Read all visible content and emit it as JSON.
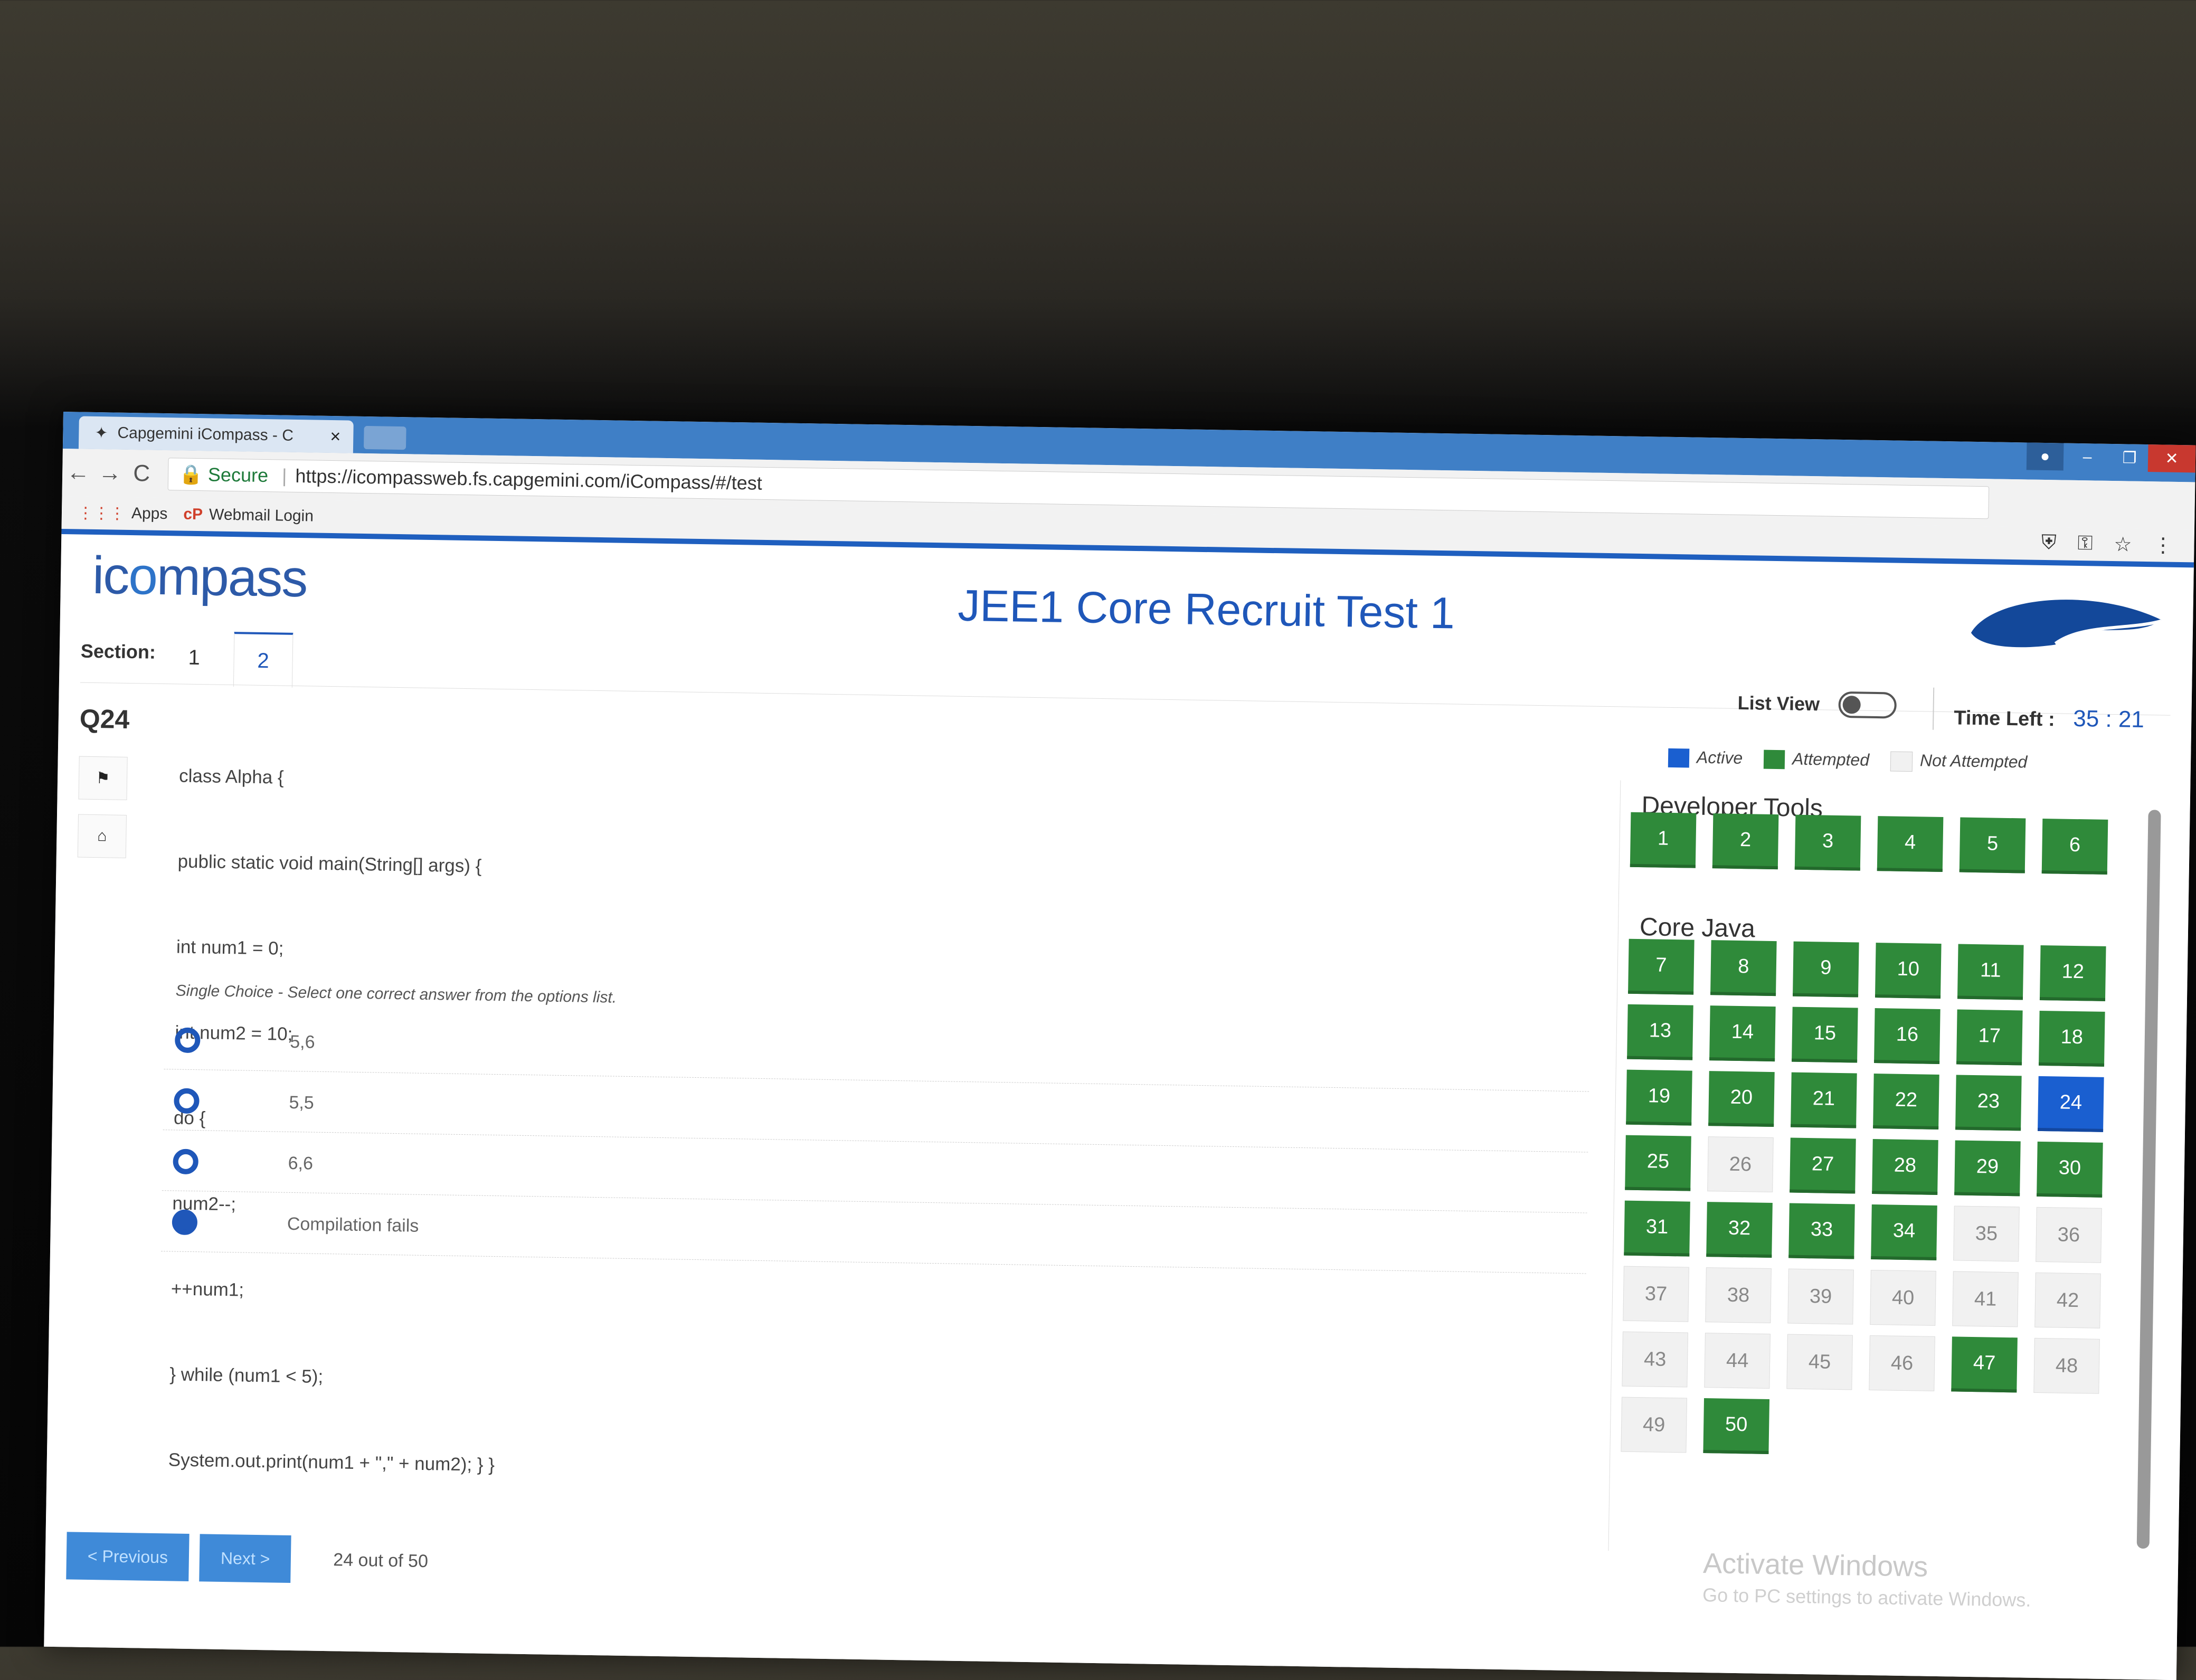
{
  "browser": {
    "tab_title": "Capgemini iCompass - C",
    "tab_close": "×",
    "secure_label": "Secure",
    "url": "https://icompassweb.fs.capgemini.com/iCompass/#/test",
    "bookmarks": [
      {
        "label": "Apps",
        "icon": "apps-grid-icon"
      },
      {
        "label": "Webmail Login",
        "icon": "webmail-icon"
      }
    ],
    "back": "←",
    "forward": "→",
    "reload": "C"
  },
  "header": {
    "logo_left": "ic",
    "logo_o": "o",
    "logo_right": "mpass",
    "title": "JEE1 Core Recruit Test 1",
    "brand_color": "#1f57b9"
  },
  "section": {
    "label": "Section:",
    "tabs": [
      "1",
      "2"
    ],
    "active_tab": "2"
  },
  "controls": {
    "list_view_label": "List View",
    "list_view_on": false,
    "time_left_label": "Time Left :",
    "time_left_value": "35 : 21"
  },
  "question": {
    "number": "Q24",
    "code_lines": [
      "class Alpha {",
      "public static void main(String[] args) {",
      "int num1 = 0;",
      "int num2 = 10;",
      "do {",
      "num2--;",
      "++num1;",
      "} while (num1 < 5);",
      "System.out.print(num1 + \",\" + num2); } }"
    ],
    "hint": "Single Choice - Select one correct answer from the options list.",
    "options": [
      {
        "text": "5,6",
        "selected": false
      },
      {
        "text": "5,5",
        "selected": false
      },
      {
        "text": "6,6",
        "selected": false
      },
      {
        "text": "Compilation fails",
        "selected": true
      }
    ]
  },
  "legend": {
    "active": "Active",
    "attempted": "Attempted",
    "not_attempted": "Not Attempted",
    "active_color": "#1a5fd0",
    "attempted_color": "#2f8a3a",
    "not_attempted_color": "#f1f1f1"
  },
  "palette": {
    "sections": [
      {
        "name": "Developer Tools",
        "questions": [
          {
            "n": "1",
            "s": "attempted"
          },
          {
            "n": "2",
            "s": "attempted"
          },
          {
            "n": "3",
            "s": "attempted"
          },
          {
            "n": "4",
            "s": "attempted"
          },
          {
            "n": "5",
            "s": "attempted"
          },
          {
            "n": "6",
            "s": "attempted"
          }
        ]
      },
      {
        "name": "Core Java",
        "questions": [
          {
            "n": "7",
            "s": "attempted"
          },
          {
            "n": "8",
            "s": "attempted"
          },
          {
            "n": "9",
            "s": "attempted"
          },
          {
            "n": "10",
            "s": "attempted"
          },
          {
            "n": "11",
            "s": "attempted"
          },
          {
            "n": "12",
            "s": "attempted"
          },
          {
            "n": "13",
            "s": "attempted"
          },
          {
            "n": "14",
            "s": "attempted"
          },
          {
            "n": "15",
            "s": "attempted"
          },
          {
            "n": "16",
            "s": "attempted"
          },
          {
            "n": "17",
            "s": "attempted"
          },
          {
            "n": "18",
            "s": "attempted"
          },
          {
            "n": "19",
            "s": "attempted"
          },
          {
            "n": "20",
            "s": "attempted"
          },
          {
            "n": "21",
            "s": "attempted"
          },
          {
            "n": "22",
            "s": "attempted"
          },
          {
            "n": "23",
            "s": "attempted"
          },
          {
            "n": "24",
            "s": "active"
          },
          {
            "n": "25",
            "s": "attempted"
          },
          {
            "n": "26",
            "s": "notattempted"
          },
          {
            "n": "27",
            "s": "attempted"
          },
          {
            "n": "28",
            "s": "attempted"
          },
          {
            "n": "29",
            "s": "attempted"
          },
          {
            "n": "30",
            "s": "attempted"
          },
          {
            "n": "31",
            "s": "attempted"
          },
          {
            "n": "32",
            "s": "attempted"
          },
          {
            "n": "33",
            "s": "attempted"
          },
          {
            "n": "34",
            "s": "attempted"
          },
          {
            "n": "35",
            "s": "notattempted"
          },
          {
            "n": "36",
            "s": "notattempted"
          },
          {
            "n": "37",
            "s": "notattempted"
          },
          {
            "n": "38",
            "s": "notattempted"
          },
          {
            "n": "39",
            "s": "notattempted"
          },
          {
            "n": "40",
            "s": "notattempted"
          },
          {
            "n": "41",
            "s": "notattempted"
          },
          {
            "n": "42",
            "s": "notattempted"
          },
          {
            "n": "43",
            "s": "notattempted"
          },
          {
            "n": "44",
            "s": "notattempted"
          },
          {
            "n": "45",
            "s": "notattempted"
          },
          {
            "n": "46",
            "s": "notattempted"
          },
          {
            "n": "47",
            "s": "attempted"
          },
          {
            "n": "48",
            "s": "notattempted"
          },
          {
            "n": "49",
            "s": "notattempted"
          },
          {
            "n": "50",
            "s": "attempted"
          }
        ]
      }
    ]
  },
  "footer": {
    "previous_label": "< Previous",
    "next_label": "Next >",
    "progress": "24 out of 50"
  },
  "watermark": {
    "line1": "Activate Windows",
    "line2": "Go to PC settings to activate Windows."
  }
}
